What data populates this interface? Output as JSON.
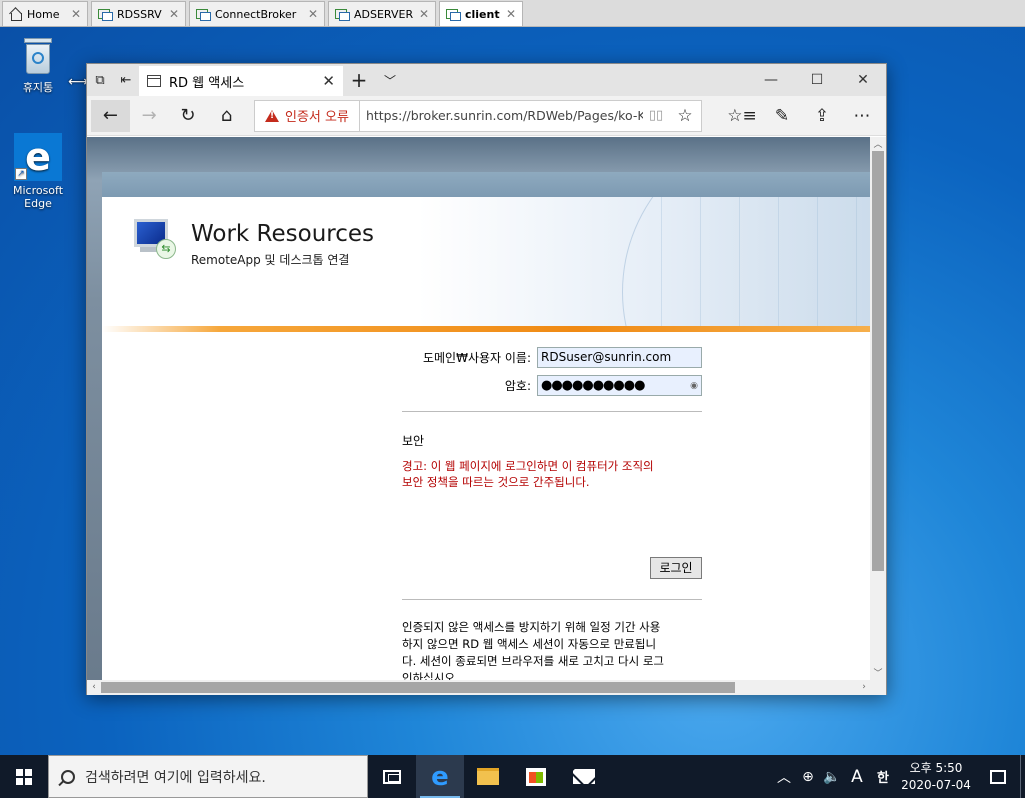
{
  "vm_tabs": [
    {
      "label": "Home"
    },
    {
      "label": "RDSSRV"
    },
    {
      "label": "ConnectBroker"
    },
    {
      "label": "ADSERVER"
    },
    {
      "label": "client"
    }
  ],
  "desktop": {
    "recycle_bin_label": "휴지통",
    "edge_label_line1": "Microsoft",
    "edge_label_line2": "Edge"
  },
  "browser": {
    "tab_title": "RD 웹 액세스",
    "cert_error": "인증서 오류",
    "url": "https://broker.sunrin.com/RDWeb/Pages/ko-KR/login.aspx"
  },
  "page": {
    "title": "Work Resources",
    "subtitle": "RemoteApp 및 데스크톱 연결",
    "username_label": "도메인₩사용자 이름:",
    "username_value": "RDSuser@sunrin.com",
    "password_label": "암호:",
    "password_mask": "●●●●●●●●●●",
    "security_heading": "보안",
    "warning_line1": "경고: 이 웹 페이지에 로그인하면 이 컴퓨터가 조직의",
    "warning_line2": "보안 정책을 따르는 것으로 간주됩니다.",
    "login_button": "로그인",
    "info_line1": "인증되지 않은 액세스를 방지하기 위해 일정 기간 사용",
    "info_line2": "하지 않으면 RD 웹 액세스 세션이 자동으로 만료됩니",
    "info_line3": "다. 세션이 종료되면 브라우저를 새로 고치고 다시 로그",
    "info_line4": "인하십시오."
  },
  "taskbar": {
    "search_placeholder": "검색하려면 여기에 입력하세요.",
    "ime_mode": "A",
    "ime_lang": "한",
    "time": "오후 5:50",
    "date": "2020-07-04"
  },
  "icons": {
    "vm_home": "home-icon",
    "vm_machine": "virtual-machine-icon",
    "back": "back-arrow-icon",
    "forward": "forward-arrow-icon",
    "refresh": "refresh-icon",
    "home": "home-icon",
    "favorites": "star-icon",
    "hub": "favorites-hub-icon",
    "notes": "pen-icon",
    "share": "share-icon",
    "more": "more-icon"
  }
}
